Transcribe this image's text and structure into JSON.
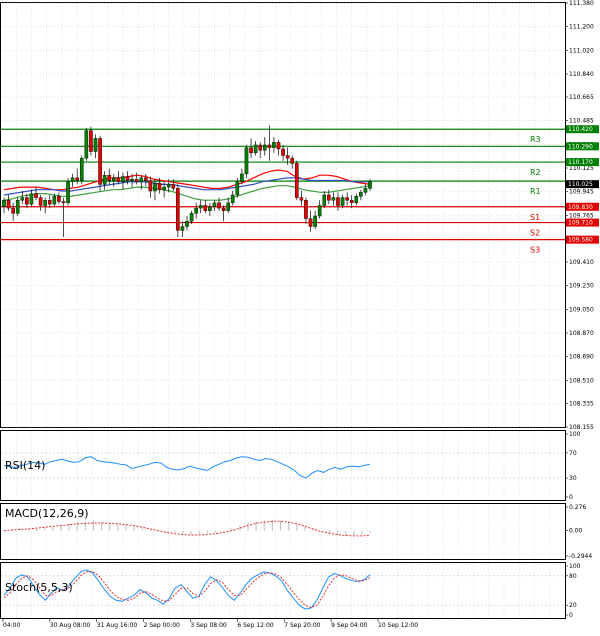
{
  "chart_data": [
    {
      "type": "candlestick",
      "panel": "price",
      "ylim": [
        108.155,
        111.38
      ],
      "y_ticks": [
        "111.380",
        "111.200",
        "111.020",
        "110.840",
        "110.665",
        "110.485",
        "110.305",
        "110.125",
        "109.945",
        "109.765",
        "109.590",
        "109.410",
        "109.230",
        "109.050",
        "108.870",
        "108.690",
        "108.510",
        "108.335",
        "108.155"
      ],
      "x_ticks": [
        "04:00",
        "30 Aug 08:00",
        "31 Aug 16:00",
        "2 Sep 00:00",
        "3 Sep 08:00",
        "6 Sep 12:00",
        "7 Sep 20:00",
        "9 Sep 04:00",
        "10 Sep 12:00"
      ],
      "current_price": "110.025",
      "levels": [
        {
          "label": "R3",
          "value": 110.42,
          "text": "110.420",
          "color": "#008000"
        },
        {
          "label": "",
          "value": 110.29,
          "text": "110.290",
          "color": "#008000"
        },
        {
          "label": "R2",
          "value": 110.17,
          "text": "110.170",
          "color": "#008000"
        },
        {
          "label": "R1",
          "value": 110.025,
          "text": "",
          "color": "#008000"
        },
        {
          "label": "S1",
          "value": 109.83,
          "text": "109.830",
          "color": "#e00000"
        },
        {
          "label": "S2",
          "value": 109.71,
          "text": "109.710",
          "color": "#e00000"
        },
        {
          "label": "S3",
          "value": 109.58,
          "text": "109.580",
          "color": "#e00000"
        }
      ],
      "ohlc": [
        [
          109.83,
          109.9,
          109.78,
          109.88
        ],
        [
          109.88,
          109.92,
          109.8,
          109.82
        ],
        [
          109.82,
          109.86,
          109.72,
          109.78
        ],
        [
          109.78,
          109.9,
          109.76,
          109.88
        ],
        [
          109.88,
          109.95,
          109.85,
          109.9
        ],
        [
          109.9,
          109.93,
          109.82,
          109.85
        ],
        [
          109.85,
          109.96,
          109.83,
          109.93
        ],
        [
          109.93,
          109.98,
          109.88,
          109.9
        ],
        [
          109.9,
          109.92,
          109.8,
          109.84
        ],
        [
          109.84,
          109.9,
          109.78,
          109.88
        ],
        [
          109.88,
          109.92,
          109.82,
          109.85
        ],
        [
          109.85,
          109.93,
          109.83,
          109.91
        ],
        [
          109.91,
          109.94,
          109.85,
          109.87
        ],
        [
          109.87,
          109.9,
          109.6,
          109.86
        ],
        [
          109.86,
          110.05,
          109.84,
          110.02
        ],
        [
          110.02,
          110.08,
          109.98,
          110.05
        ],
        [
          110.05,
          110.12,
          110.0,
          110.03
        ],
        [
          110.03,
          110.22,
          110.0,
          110.2
        ],
        [
          110.2,
          110.43,
          110.18,
          110.41
        ],
        [
          110.41,
          110.44,
          110.22,
          110.25
        ],
        [
          110.25,
          110.38,
          110.2,
          110.35
        ],
        [
          110.35,
          110.37,
          109.95,
          110.0
        ],
        [
          110.0,
          110.1,
          109.96,
          110.07
        ],
        [
          110.07,
          110.12,
          110.0,
          110.03
        ],
        [
          110.03,
          110.08,
          109.98,
          110.05
        ],
        [
          110.05,
          110.1,
          110.0,
          110.02
        ],
        [
          110.02,
          110.09,
          109.96,
          110.06
        ],
        [
          110.06,
          110.1,
          110.0,
          110.03
        ],
        [
          110.03,
          110.08,
          109.98,
          110.04
        ],
        [
          110.04,
          110.09,
          110.0,
          110.02
        ],
        [
          110.02,
          110.07,
          109.96,
          110.05
        ],
        [
          110.05,
          110.08,
          109.99,
          110.03
        ],
        [
          110.03,
          110.06,
          109.9,
          109.95
        ],
        [
          109.95,
          110.04,
          109.88,
          110.01
        ],
        [
          110.01,
          110.05,
          109.93,
          109.96
        ],
        [
          109.96,
          110.02,
          109.9,
          109.98
        ],
        [
          109.98,
          110.04,
          109.94,
          110.0
        ],
        [
          110.0,
          110.04,
          109.95,
          109.97
        ],
        [
          109.97,
          110.0,
          109.6,
          109.65
        ],
        [
          109.65,
          109.72,
          109.6,
          109.68
        ],
        [
          109.68,
          109.76,
          109.65,
          109.72
        ],
        [
          109.72,
          109.8,
          109.7,
          109.78
        ],
        [
          109.78,
          109.86,
          109.74,
          109.82
        ],
        [
          109.82,
          109.88,
          109.78,
          109.84
        ],
        [
          109.84,
          109.88,
          109.78,
          109.8
        ],
        [
          109.8,
          109.86,
          109.76,
          109.83
        ],
        [
          109.83,
          109.88,
          109.8,
          109.86
        ],
        [
          109.86,
          109.9,
          109.8,
          109.82
        ],
        [
          109.82,
          109.84,
          109.72,
          109.8
        ],
        [
          109.8,
          109.9,
          109.78,
          109.86
        ],
        [
          109.86,
          109.95,
          109.84,
          109.92
        ],
        [
          109.92,
          110.05,
          109.9,
          110.02
        ],
        [
          110.02,
          110.12,
          110.0,
          110.08
        ],
        [
          110.08,
          110.3,
          110.05,
          110.28
        ],
        [
          110.28,
          110.35,
          110.2,
          110.24
        ],
        [
          110.24,
          110.33,
          110.22,
          110.3
        ],
        [
          110.3,
          110.32,
          110.2,
          110.26
        ],
        [
          110.26,
          110.36,
          110.22,
          110.3
        ],
        [
          110.3,
          110.45,
          110.18,
          110.28
        ],
        [
          110.28,
          110.36,
          110.24,
          110.32
        ],
        [
          110.32,
          110.34,
          110.22,
          110.27
        ],
        [
          110.27,
          110.3,
          110.18,
          110.22
        ],
        [
          110.22,
          110.28,
          110.15,
          110.2
        ],
        [
          110.2,
          110.22,
          110.12,
          110.16
        ],
        [
          110.16,
          110.18,
          109.88,
          109.9
        ],
        [
          109.9,
          109.95,
          109.84,
          109.88
        ],
        [
          109.88,
          109.9,
          109.7,
          109.74
        ],
        [
          109.74,
          109.8,
          109.64,
          109.68
        ],
        [
          109.68,
          109.8,
          109.66,
          109.76
        ],
        [
          109.76,
          109.88,
          109.74,
          109.84
        ],
        [
          109.84,
          109.95,
          109.82,
          109.92
        ],
        [
          109.92,
          109.96,
          109.85,
          109.88
        ],
        [
          109.88,
          109.94,
          109.84,
          109.9
        ],
        [
          109.9,
          109.94,
          109.8,
          109.84
        ],
        [
          109.84,
          109.92,
          109.82,
          109.9
        ],
        [
          109.9,
          109.94,
          109.84,
          109.88
        ],
        [
          109.88,
          109.92,
          109.82,
          109.86
        ],
        [
          109.86,
          109.93,
          109.84,
          109.91
        ],
        [
          109.91,
          109.96,
          109.88,
          109.94
        ],
        [
          109.94,
          110.0,
          109.92,
          109.97
        ],
        [
          109.97,
          110.04,
          109.95,
          110.02
        ]
      ],
      "overlays": [
        {
          "name": "ema_red",
          "color": "#ff0000",
          "values": [
            109.96,
            109.97,
            109.98,
            109.98,
            109.98,
            109.97,
            109.96,
            109.96,
            109.97,
            109.98,
            110.0,
            110.02,
            110.04,
            110.05,
            110.05,
            110.06,
            110.07,
            110.06,
            110.04,
            110.03,
            110.02,
            110.01,
            110.0,
            109.99,
            109.98,
            109.97,
            109.97,
            109.98,
            110.0,
            110.02,
            110.05,
            110.08,
            110.1,
            110.11,
            110.1,
            110.06,
            110.04,
            110.05,
            110.07,
            110.07,
            110.06,
            110.04,
            110.02,
            110.01,
            110.0
          ]
        },
        {
          "name": "ema_blue",
          "color": "#3050c0",
          "values": [
            109.92,
            109.93,
            109.94,
            109.95,
            109.96,
            109.96,
            109.96,
            109.95,
            109.95,
            109.96,
            109.97,
            109.98,
            109.99,
            110.0,
            110.01,
            110.02,
            110.02,
            110.02,
            110.01,
            110.0,
            110.0,
            109.99,
            109.98,
            109.97,
            109.96,
            109.96,
            109.96,
            109.97,
            109.98,
            109.99,
            110.0,
            110.02,
            110.03,
            110.04,
            110.05,
            110.05,
            110.04,
            110.03,
            110.03,
            110.03,
            110.03,
            110.03,
            110.02,
            110.02,
            110.02
          ]
        },
        {
          "name": "ema_green",
          "color": "#40a040",
          "values": [
            109.88,
            109.89,
            109.91,
            109.92,
            109.93,
            109.93,
            109.92,
            109.91,
            109.91,
            109.92,
            109.93,
            109.94,
            109.95,
            109.96,
            109.96,
            109.97,
            109.98,
            109.98,
            109.97,
            109.96,
            109.95,
            109.93,
            109.91,
            109.89,
            109.88,
            109.88,
            109.88,
            109.89,
            109.91,
            109.93,
            109.95,
            109.97,
            109.98,
            109.99,
            109.99,
            109.98,
            109.96,
            109.95,
            109.94,
            109.94,
            109.95,
            109.96,
            109.97,
            109.98,
            109.99
          ]
        }
      ]
    },
    {
      "type": "line",
      "panel": "rsi",
      "title": "RSI(14)",
      "ylim": [
        0,
        100
      ],
      "y_ticks": [
        "100",
        "70",
        "30",
        "0"
      ],
      "series": [
        {
          "color": "#1e90ff",
          "values": [
            50,
            48,
            47,
            50,
            52,
            55,
            54,
            52,
            56,
            58,
            60,
            57,
            55,
            56,
            62,
            64,
            58,
            56,
            55,
            54,
            52,
            51,
            45,
            48,
            50,
            52,
            55,
            54,
            47,
            44,
            43,
            45,
            49,
            46,
            44,
            42,
            48,
            52,
            56,
            58,
            62,
            64,
            63,
            60,
            58,
            61,
            60,
            56,
            52,
            48,
            42,
            34,
            30,
            38,
            42,
            39,
            44,
            47,
            44,
            48,
            49,
            48,
            50,
            52
          ]
        }
      ]
    },
    {
      "type": "bar+line",
      "panel": "macd",
      "title": "MACD(12,26,9)",
      "ylim": [
        -0.2944,
        0.276
      ],
      "y_ticks": [
        "0.276",
        "0.00",
        "-0.2944"
      ],
      "histogram": [
        0.01,
        0.02,
        0.03,
        0.02,
        0.02,
        0.04,
        0.05,
        0.06,
        0.08,
        0.1,
        0.11,
        0.12,
        0.1,
        0.09,
        0.08,
        0.07,
        0.05,
        0.03,
        0.01,
        -0.01,
        -0.02,
        -0.03,
        -0.04,
        -0.05,
        -0.04,
        -0.03,
        -0.02,
        0.0,
        0.03,
        0.06,
        0.09,
        0.11,
        0.12,
        0.13,
        0.12,
        0.1,
        0.08,
        0.05,
        0.02,
        -0.02,
        -0.04,
        -0.05,
        -0.06,
        -0.05,
        -0.04,
        -0.03
      ],
      "signal": [
        0.0,
        0.01,
        0.015,
        0.02,
        0.03,
        0.04,
        0.05,
        0.06,
        0.07,
        0.08,
        0.085,
        0.09,
        0.09,
        0.085,
        0.08,
        0.07,
        0.06,
        0.04,
        0.02,
        0.0,
        -0.02,
        -0.035,
        -0.045,
        -0.05,
        -0.05,
        -0.045,
        -0.035,
        -0.02,
        0.0,
        0.03,
        0.06,
        0.085,
        0.1,
        0.11,
        0.11,
        0.1,
        0.08,
        0.05,
        0.02,
        -0.01,
        -0.03,
        -0.045,
        -0.055,
        -0.06,
        -0.06,
        -0.055
      ]
    },
    {
      "type": "line",
      "panel": "stoch",
      "title": "Stoch(5,5,3)",
      "ylim": [
        0,
        100
      ],
      "y_ticks": [
        "100",
        "80",
        "20",
        "0"
      ],
      "series": [
        {
          "color": "#1e90ff",
          "values": [
            40,
            55,
            75,
            82,
            78,
            60,
            42,
            30,
            45,
            55,
            50,
            60,
            75,
            88,
            92,
            86,
            70,
            52,
            38,
            30,
            28,
            34,
            40,
            52,
            46,
            35,
            30,
            22,
            34,
            55,
            62,
            48,
            34,
            38,
            62,
            78,
            70,
            56,
            40,
            30,
            45,
            62,
            75,
            82,
            88,
            86,
            80,
            70,
            50,
            35,
            20,
            12,
            14,
            30,
            55,
            78,
            85,
            80,
            74,
            70,
            68,
            72,
            82
          ]
        },
        {
          "color": "#e03030",
          "values": [
            35,
            45,
            62,
            75,
            80,
            72,
            56,
            40,
            40,
            48,
            52,
            56,
            66,
            80,
            88,
            89,
            80,
            66,
            50,
            38,
            32,
            30,
            34,
            44,
            48,
            42,
            35,
            28,
            30,
            42,
            54,
            55,
            44,
            38,
            48,
            64,
            72,
            66,
            52,
            40,
            40,
            52,
            65,
            76,
            84,
            86,
            84,
            76,
            62,
            46,
            32,
            20,
            15,
            20,
            38,
            60,
            76,
            82,
            80,
            74,
            70,
            70,
            76
          ]
        }
      ]
    }
  ]
}
